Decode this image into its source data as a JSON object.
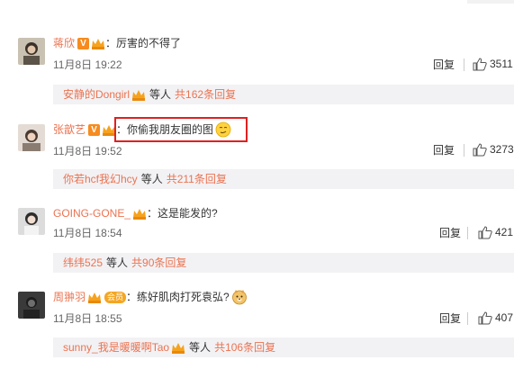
{
  "comments": [
    {
      "username": "蒋欣",
      "separator": "：",
      "text": "厉害的不得了",
      "time": "11月8日 19:22",
      "reply_label": "回复",
      "like_count": "3511",
      "sub": {
        "user": "安静的Dongirl",
        "etal": "等人",
        "total": "共162条回复"
      }
    },
    {
      "username": "张歆艺",
      "separator": "：",
      "text": "你偷我朋友圈的图",
      "time": "11月8日 19:52",
      "reply_label": "回复",
      "like_count": "3273",
      "sub": {
        "user": "你若hcf我幻hcy",
        "etal": "等人",
        "total": "共211条回复"
      }
    },
    {
      "username": "GOING-GONE_",
      "separator": "：",
      "text": "这是能发的?",
      "time": "11月8日 18:54",
      "reply_label": "回复",
      "like_count": "421",
      "sub": {
        "user": "纬纬525",
        "etal": "等人",
        "total": "共90条回复"
      }
    },
    {
      "username": "周翀羽",
      "separator": "：",
      "text": "练好肌肉打死袁弘?",
      "member_badge": "会员",
      "time": "11月8日 18:55",
      "reply_label": "回复",
      "like_count": "407",
      "sub": {
        "user": "sunny_我是暖暖啊Tao",
        "etal": "等人",
        "total": "共106条回复"
      }
    }
  ],
  "colors": {
    "link": "#eb7350",
    "text": "#333333",
    "muted": "#666666",
    "subbox_bg": "#f2f2f5",
    "highlight": "#e02020"
  },
  "icons": {
    "like": "thumbs-up-icon",
    "verified": "v-badge-icon",
    "vip": "crown-icon"
  }
}
